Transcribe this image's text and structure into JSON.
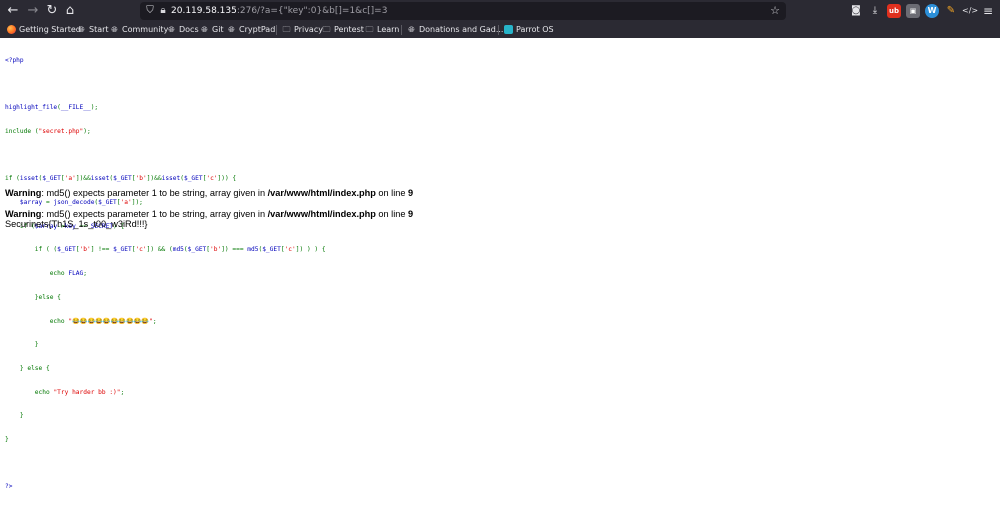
{
  "toolbar": {
    "back_icon": "back-arrow-icon",
    "forward_icon": "forward-arrow-icon",
    "reload_icon": "reload-icon",
    "home_icon": "home-icon",
    "back_glyph": "←",
    "forward_glyph": "→",
    "reload_glyph": "↻",
    "home_glyph": "⌂",
    "url_host": "20.119.58.135",
    "url_rest": ":276/?a={\"key\":0}&b[]=1&c[]=3",
    "shield_glyph": "⛉",
    "lock_glyph": "🔒︎",
    "star_glyph": "☆",
    "pocket_glyph": "◙",
    "download_glyph": "⤓",
    "ext1_label": "ub",
    "ext2_label": "▣",
    "ext3_label": "W",
    "ext4_glyph": "✎",
    "devtools_glyph": "</>",
    "menu_glyph": "≡"
  },
  "bookmarks": [
    {
      "label": "Getting Started",
      "icon": "firefox-icon"
    },
    {
      "label": "Start",
      "icon": "globe-icon"
    },
    {
      "label": "Community",
      "icon": "globe-icon"
    },
    {
      "label": "Docs",
      "icon": "globe-icon"
    },
    {
      "label": "Git",
      "icon": "globe-icon"
    },
    {
      "label": "CryptPad",
      "icon": "globe-icon"
    },
    {
      "label": "Privacy",
      "icon": "folder-icon"
    },
    {
      "label": "Pentest",
      "icon": "folder-icon"
    },
    {
      "label": "Learn",
      "icon": "folder-icon"
    },
    {
      "label": "Donations and Gad...",
      "icon": "globe-icon"
    },
    {
      "label": "Parrot OS",
      "icon": "parrot-icon"
    }
  ],
  "source": {
    "l1": "<?php",
    "l3a": "highlight_file",
    "l3b": "(",
    "l3c": "__FILE__",
    "l3d": ");",
    "l4a": "include ",
    "l4b": "(",
    "l4c": "\"secret.php\"",
    "l4d": ");",
    "l6a": "if (",
    "l6b": "isset",
    "l6c": "(",
    "l6d": "$_GET",
    "l6e": "[",
    "l6f": "'a'",
    "l6g": "])&&",
    "l6h": "isset",
    "l6i": "(",
    "l6j": "$_GET",
    "l6k": "[",
    "l6l": "'b'",
    "l6m": "])&&",
    "l6n": "isset",
    "l6o": "(",
    "l6p": "$_GET",
    "l6q": "[",
    "l6r": "'c'",
    "l6s": "])) {",
    "l7a": "    $array ",
    "l7b": "= ",
    "l7c": "json_decode",
    "l7d": "(",
    "l7e": "$_GET",
    "l7f": "[",
    "l7g": "'a'",
    "l7h": "]);",
    "l8a": "    if (",
    "l8b": "$array",
    "l8c": "->",
    "l8d": "key ",
    "l8e": "== ",
    "l8f": "SECRET",
    "l8g": ") {",
    "l9a": "        if ( (",
    "l9b": "$_GET",
    "l9c": "[",
    "l9d": "'b'",
    "l9e": "] !== ",
    "l9f": "$_GET",
    "l9g": "[",
    "l9h": "'c'",
    "l9i": "]) && (",
    "l9j": "md5",
    "l9k": "(",
    "l9l": "$_GET",
    "l9m": "[",
    "l9n": "'b'",
    "l9o": "]) === ",
    "l9p": "md5",
    "l9q": "(",
    "l9r": "$_GET",
    "l9s": "[",
    "l9t": "'c'",
    "l9u": "]) ) ) {",
    "l10a": "            echo ",
    "l10b": "FLAG",
    "l10c": ";",
    "l11a": "        }",
    "l11b": "else ",
    "l11c": "{",
    "l12a": "            echo ",
    "l12b": "\"😂😂😂😂😂😂😂😂😂😂\"",
    "l12c": ";",
    "l13": "        }",
    "l14a": "    } ",
    "l14b": "else ",
    "l14c": "{",
    "l15a": "        echo ",
    "l15b": "\"Try harder bb :)\"",
    "l15c": ";",
    "l16": "    }",
    "l17": "}",
    "l19": "?>"
  },
  "output": {
    "warning_label": "Warning",
    "warning_text_1": ": md5() expects parameter 1 to be string, array given in ",
    "file_path": "/var/www/html/index.php",
    "on_line": " on line ",
    "line_no": "9",
    "flag": "Securinets{Th1S_1s_t00_w3iRd!!!}"
  }
}
